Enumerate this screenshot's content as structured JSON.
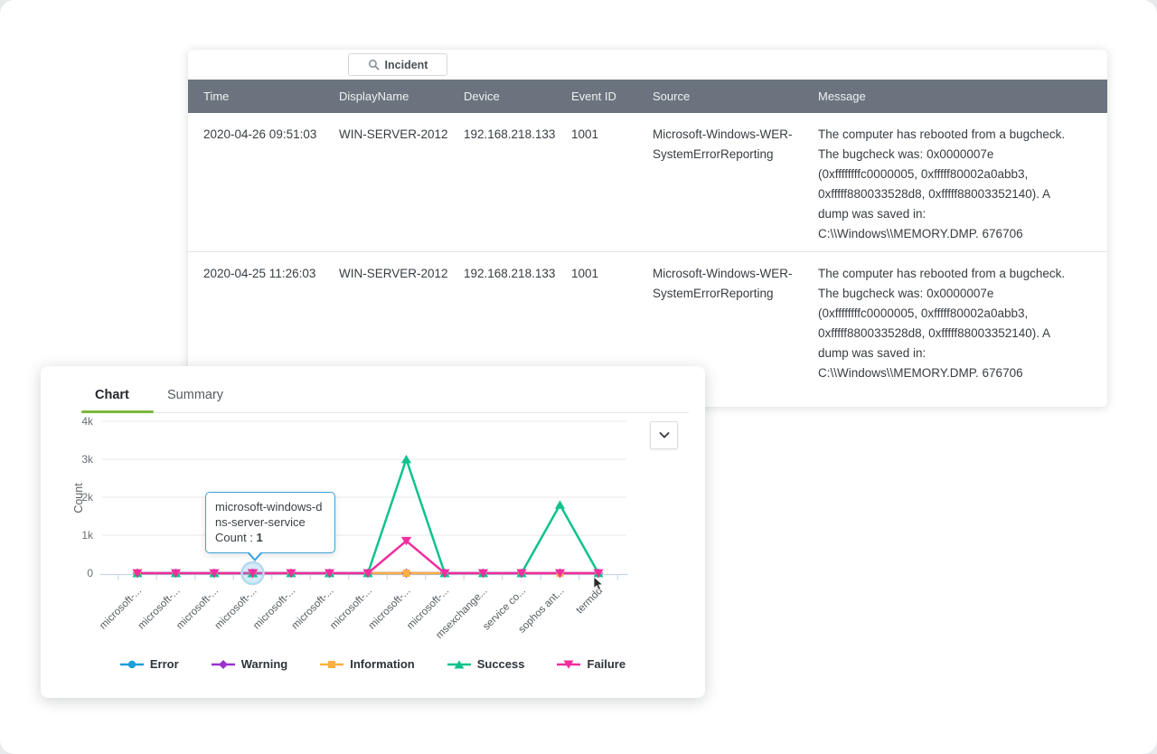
{
  "incident_button": {
    "label": "Incident"
  },
  "table": {
    "columns": [
      "Time",
      "DisplayName",
      "Device",
      "Event ID",
      "Source",
      "Message"
    ],
    "rows": [
      {
        "time": "2020-04-26 09:51:03",
        "display_name": "WIN-SERVER-2012",
        "device": "192.168.218.133",
        "event_id": "1001",
        "source": "Microsoft-Windows-WER-SystemErrorReporting",
        "message": "The computer has rebooted from a bugcheck. The bugcheck was: 0x0000007e (0xffffffffc0000005, 0xfffff80002a0abb3, 0xfffff880033528d8, 0xfffff88003352140). A dump was saved in: C:\\\\Windows\\\\MEMORY.DMP.  676706"
      },
      {
        "time": "2020-04-25 11:26:03",
        "display_name": "WIN-SERVER-2012",
        "device": "192.168.218.133",
        "event_id": "1001",
        "source": "Microsoft-Windows-WER-SystemErrorReporting",
        "message": "The computer has rebooted from a bugcheck. The bugcheck was: 0x0000007e (0xffffffffc0000005, 0xfffff80002a0abb3, 0xfffff880033528d8, 0xfffff88003352140). A dump was saved in: C:\\\\Windows\\\\MEMORY.DMP.  676706"
      }
    ]
  },
  "panel": {
    "tabs": [
      {
        "label": "Chart",
        "active": true
      },
      {
        "label": "Summary",
        "active": false
      }
    ],
    "active_tab_color": "#7cb63d"
  },
  "chart_data": {
    "type": "line",
    "ylabel": "Count",
    "ylim": [
      0,
      4000
    ],
    "yticks": [
      "0",
      "1k",
      "2k",
      "3k",
      "4k"
    ],
    "grid": true,
    "legend_position": "bottom",
    "categories": [
      "microsoft-...",
      "microsoft-...",
      "microsoft-...",
      "microsoft-...",
      "microsoft-...",
      "microsoft-...",
      "microsoft-...",
      "microsoft-...",
      "microsoft-...",
      "msexchange...",
      "service co...",
      "sophos ant...",
      "termdd"
    ],
    "series": [
      {
        "name": "Error",
        "color": "#1e9ed9",
        "marker": "circle",
        "values": [
          0,
          0,
          0,
          0,
          0,
          0,
          0,
          0,
          0,
          0,
          0,
          0,
          0
        ]
      },
      {
        "name": "Warning",
        "color": "#9c30d0",
        "marker": "diamond",
        "values": [
          0,
          0,
          0,
          0,
          0,
          0,
          0,
          0,
          0,
          0,
          0,
          0,
          0
        ]
      },
      {
        "name": "Information",
        "color": "#fbb041",
        "marker": "square",
        "values": [
          0,
          0,
          0,
          0,
          0,
          0,
          0,
          0,
          0,
          0,
          0,
          0,
          0
        ]
      },
      {
        "name": "Success",
        "color": "#0fc28d",
        "marker": "triangle-up",
        "values": [
          0,
          0,
          0,
          0,
          0,
          0,
          0,
          3000,
          0,
          0,
          0,
          1800,
          0
        ]
      },
      {
        "name": "Failure",
        "color": "#f22da0",
        "marker": "triangle-down",
        "values": [
          0,
          0,
          0,
          0,
          0,
          0,
          0,
          850,
          0,
          0,
          0,
          0,
          0
        ]
      }
    ],
    "tooltip": {
      "category_full": "microsoft-windows-dns-server-service",
      "count_label": "Count :",
      "count": "1",
      "point_index": 3
    },
    "colors": {
      "axis": "#c9d7ee",
      "gridline": "#e9e9e9",
      "tooltip_border": "#3ea2db",
      "table_header_bg": "#6b747e"
    }
  }
}
